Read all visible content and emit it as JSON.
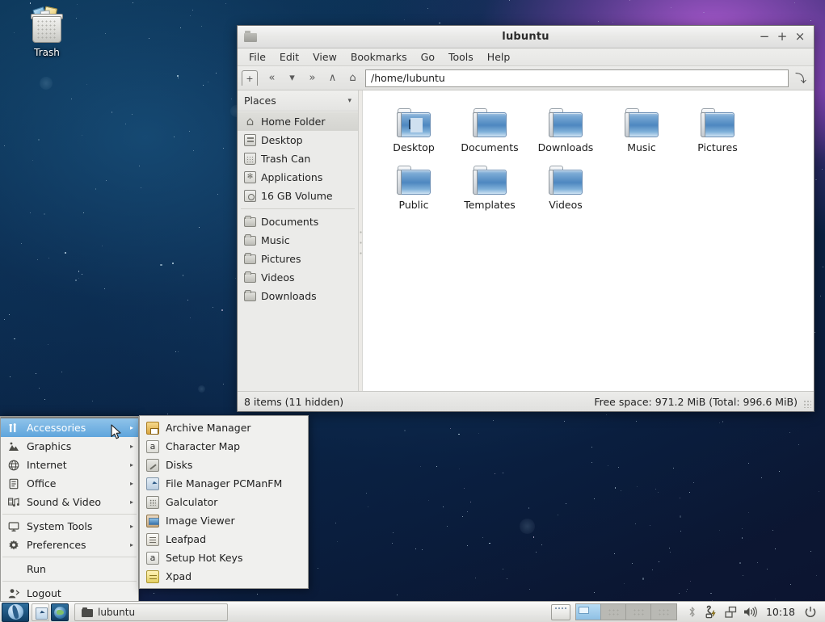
{
  "desktop": {
    "icons": [
      {
        "name": "Trash",
        "icon": "trash-icon"
      }
    ]
  },
  "file_manager": {
    "title": "lubuntu",
    "window_icon": "folder-icon",
    "window_buttons": {
      "minimize": "−",
      "maximize": "+",
      "close": "×"
    },
    "menus": [
      "File",
      "Edit",
      "View",
      "Bookmarks",
      "Go",
      "Tools",
      "Help"
    ],
    "toolbar": {
      "new_tab": "+",
      "back": "«",
      "history": "▾",
      "forward": "»",
      "up": "∧",
      "home": "⌂",
      "go": "⤵"
    },
    "path": "/home/lubuntu",
    "path_placeholder": "/home/lubuntu",
    "sidebar": {
      "header": "Places",
      "header_caret": "▾",
      "group1": [
        {
          "label": "Home Folder",
          "icon": "home-icon",
          "selected": true
        },
        {
          "label": "Desktop",
          "icon": "desktop-icon",
          "selected": false
        },
        {
          "label": "Trash Can",
          "icon": "trash-icon",
          "selected": false
        },
        {
          "label": "Applications",
          "icon": "applications-icon",
          "selected": false
        },
        {
          "label": "16 GB Volume",
          "icon": "volume-icon",
          "selected": false
        }
      ],
      "group2": [
        {
          "label": "Documents",
          "icon": "folder-icon"
        },
        {
          "label": "Music",
          "icon": "folder-icon"
        },
        {
          "label": "Pictures",
          "icon": "folder-icon"
        },
        {
          "label": "Videos",
          "icon": "folder-icon"
        },
        {
          "label": "Downloads",
          "icon": "folder-icon"
        }
      ]
    },
    "files": [
      {
        "label": "Desktop",
        "icon": "folder-icon",
        "emblem": true
      },
      {
        "label": "Documents",
        "icon": "folder-icon",
        "emblem": false
      },
      {
        "label": "Downloads",
        "icon": "folder-icon",
        "emblem": false
      },
      {
        "label": "Music",
        "icon": "folder-icon",
        "emblem": false
      },
      {
        "label": "Pictures",
        "icon": "folder-icon",
        "emblem": false
      },
      {
        "label": "Public",
        "icon": "folder-icon",
        "emblem": false
      },
      {
        "label": "Templates",
        "icon": "folder-icon",
        "emblem": false
      },
      {
        "label": "Videos",
        "icon": "folder-icon",
        "emblem": false
      }
    ],
    "status": {
      "items": "8 items (11 hidden)",
      "free_space": "Free space: 971.2 MiB (Total: 996.6 MiB)"
    }
  },
  "start_menu": {
    "categories": [
      {
        "label": "Accessories",
        "icon": "accessories-icon",
        "arrow": "▸",
        "selected": true
      },
      {
        "label": "Graphics",
        "icon": "graphics-icon",
        "arrow": "▸",
        "selected": false
      },
      {
        "label": "Internet",
        "icon": "internet-icon",
        "arrow": "▸",
        "selected": false
      },
      {
        "label": "Office",
        "icon": "office-icon",
        "arrow": "▸",
        "selected": false
      },
      {
        "label": "Sound & Video",
        "icon": "sound-video-icon",
        "arrow": "▸",
        "selected": false
      }
    ],
    "system": [
      {
        "label": "System Tools",
        "icon": "system-tools-icon",
        "arrow": "▸"
      },
      {
        "label": "Preferences",
        "icon": "preferences-icon",
        "arrow": "▸"
      }
    ],
    "run": {
      "label": "Run"
    },
    "logout": {
      "label": "Logout",
      "icon": "logout-icon"
    },
    "submenu": {
      "parent": "Accessories",
      "items": [
        {
          "label": "Archive Manager",
          "icon": "archive-manager-icon"
        },
        {
          "label": "Character Map",
          "icon": "character-map-icon"
        },
        {
          "label": "Disks",
          "icon": "disks-icon"
        },
        {
          "label": "File Manager PCManFM",
          "icon": "file-manager-icon"
        },
        {
          "label": "Galculator",
          "icon": "calculator-icon"
        },
        {
          "label": "Image Viewer",
          "icon": "image-viewer-icon"
        },
        {
          "label": "Leafpad",
          "icon": "leafpad-icon"
        },
        {
          "label": "Setup Hot Keys",
          "icon": "hotkeys-icon"
        },
        {
          "label": "Xpad",
          "icon": "xpad-icon"
        }
      ]
    }
  },
  "taskbar": {
    "start_button": {
      "icon": "lubuntu-logo-icon"
    },
    "launchers": [
      {
        "icon": "file-manager-icon",
        "name": "file-manager"
      },
      {
        "icon": "web-browser-icon",
        "name": "web-browser"
      }
    ],
    "windows": [
      {
        "label": "lubuntu",
        "icon": "folder-icon",
        "active": true
      }
    ],
    "tray": {
      "show_desktop": "show-desktop-icon",
      "workspaces": [
        {
          "index": 1,
          "active": true
        },
        {
          "index": 2,
          "active": false
        },
        {
          "index": 3,
          "active": false
        },
        {
          "index": 4,
          "active": false
        }
      ],
      "bluetooth": "bluetooth-icon",
      "power_manager": "power-manager-icon",
      "window_switch": "window-switch-icon",
      "volume": "volume-icon",
      "clock": "10:18",
      "power": "power-icon"
    }
  },
  "colors": {
    "accent": "#5fa5dc",
    "desktop_blue": "#0a2546",
    "nebula_purple": "#9f5ad2",
    "folder_blue": "#4e87c0"
  }
}
